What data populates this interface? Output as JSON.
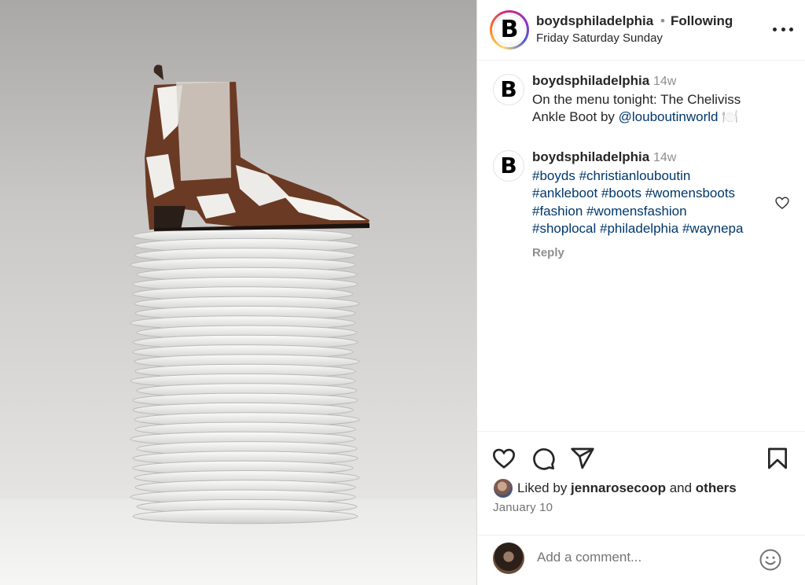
{
  "header": {
    "username": "boydsphiladelphia",
    "separator": "•",
    "follow_status": "Following",
    "subtitle": "Friday Saturday Sunday",
    "avatar_letter": "B"
  },
  "comments": [
    {
      "username": "boydsphiladelphia",
      "time": "14w",
      "text_before": "On the menu tonight: The Cheliviss Ankle Boot by ",
      "mention": "@louboutinworld",
      "emoji": " 🍽️"
    },
    {
      "username": "boydsphiladelphia",
      "time": "14w",
      "hashtags": [
        "#boyds",
        "#christianlouboutin",
        "#ankleboot",
        "#boots",
        "#womensboots",
        "#fashion",
        "#womensfashion",
        "#shoplocal",
        "#philadelphia",
        "#waynepa"
      ],
      "reply_label": "Reply"
    }
  ],
  "likes": {
    "prefix": "Liked by ",
    "user": "jennarosecoop",
    "middle": " and ",
    "others": "others"
  },
  "date": "January 10",
  "add_comment": {
    "placeholder": "Add a comment..."
  },
  "icons": {
    "more": "more-icon",
    "like": "heart-icon",
    "comment": "comment-icon",
    "share": "paper-plane-icon",
    "save": "bookmark-icon",
    "emoji": "smiley-icon"
  }
}
